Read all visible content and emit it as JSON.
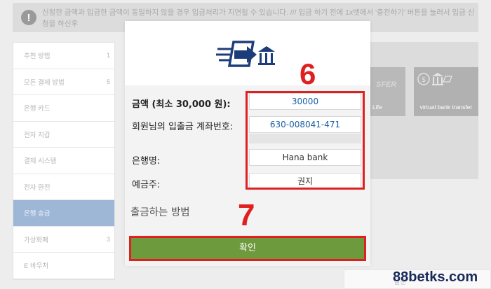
{
  "notice": {
    "icon": "exclamation-icon",
    "text": "신청한 금액과 입금한 금액이 동일하지 않을 경우 입금처리가 지연될 수 있습니다. /// 입금 하기 전에 1x벳에서 '충전하기' 버튼을 눌러서 입금 신청을 하신후"
  },
  "sidebar": {
    "items": [
      {
        "label": "추천 방법",
        "count": "1"
      },
      {
        "label": "모든 결제 방법",
        "count": "5"
      },
      {
        "label": "은행 카드",
        "count": ""
      },
      {
        "label": "전자 지갑",
        "count": ""
      },
      {
        "label": "결제 시스템",
        "count": ""
      },
      {
        "label": "전자 환전",
        "count": ""
      },
      {
        "label": "은행 송금",
        "count": ""
      },
      {
        "label": "가상화폐",
        "count": "3"
      },
      {
        "label": "E 바우처",
        "count": ""
      }
    ]
  },
  "tiles": {
    "a_logo": "SFER",
    "a_caption": "Life",
    "b_caption": "virtual bank transfer"
  },
  "bottom_tab": "질문",
  "modal": {
    "logo_icon": "bank-transfer-icon",
    "amount_label": "금액 (최소 30,000 원):",
    "amount_value": "30000",
    "account_label": "회원님의 입출금 계좌번호:",
    "account_value": "630-008041-471",
    "bank_label": "은행명:",
    "bank_value": "Hana bank",
    "holder_label": "예금주:",
    "holder_value": "권지",
    "withdraw_title": "출금하는 방법",
    "confirm_label": "확인"
  },
  "annotations": {
    "step6": "6",
    "step7": "7"
  },
  "watermark": "88betks.com",
  "colors": {
    "confirm": "#6d9a3d",
    "highlight": "#e02020",
    "active_sidebar": "#9fb7d7"
  }
}
